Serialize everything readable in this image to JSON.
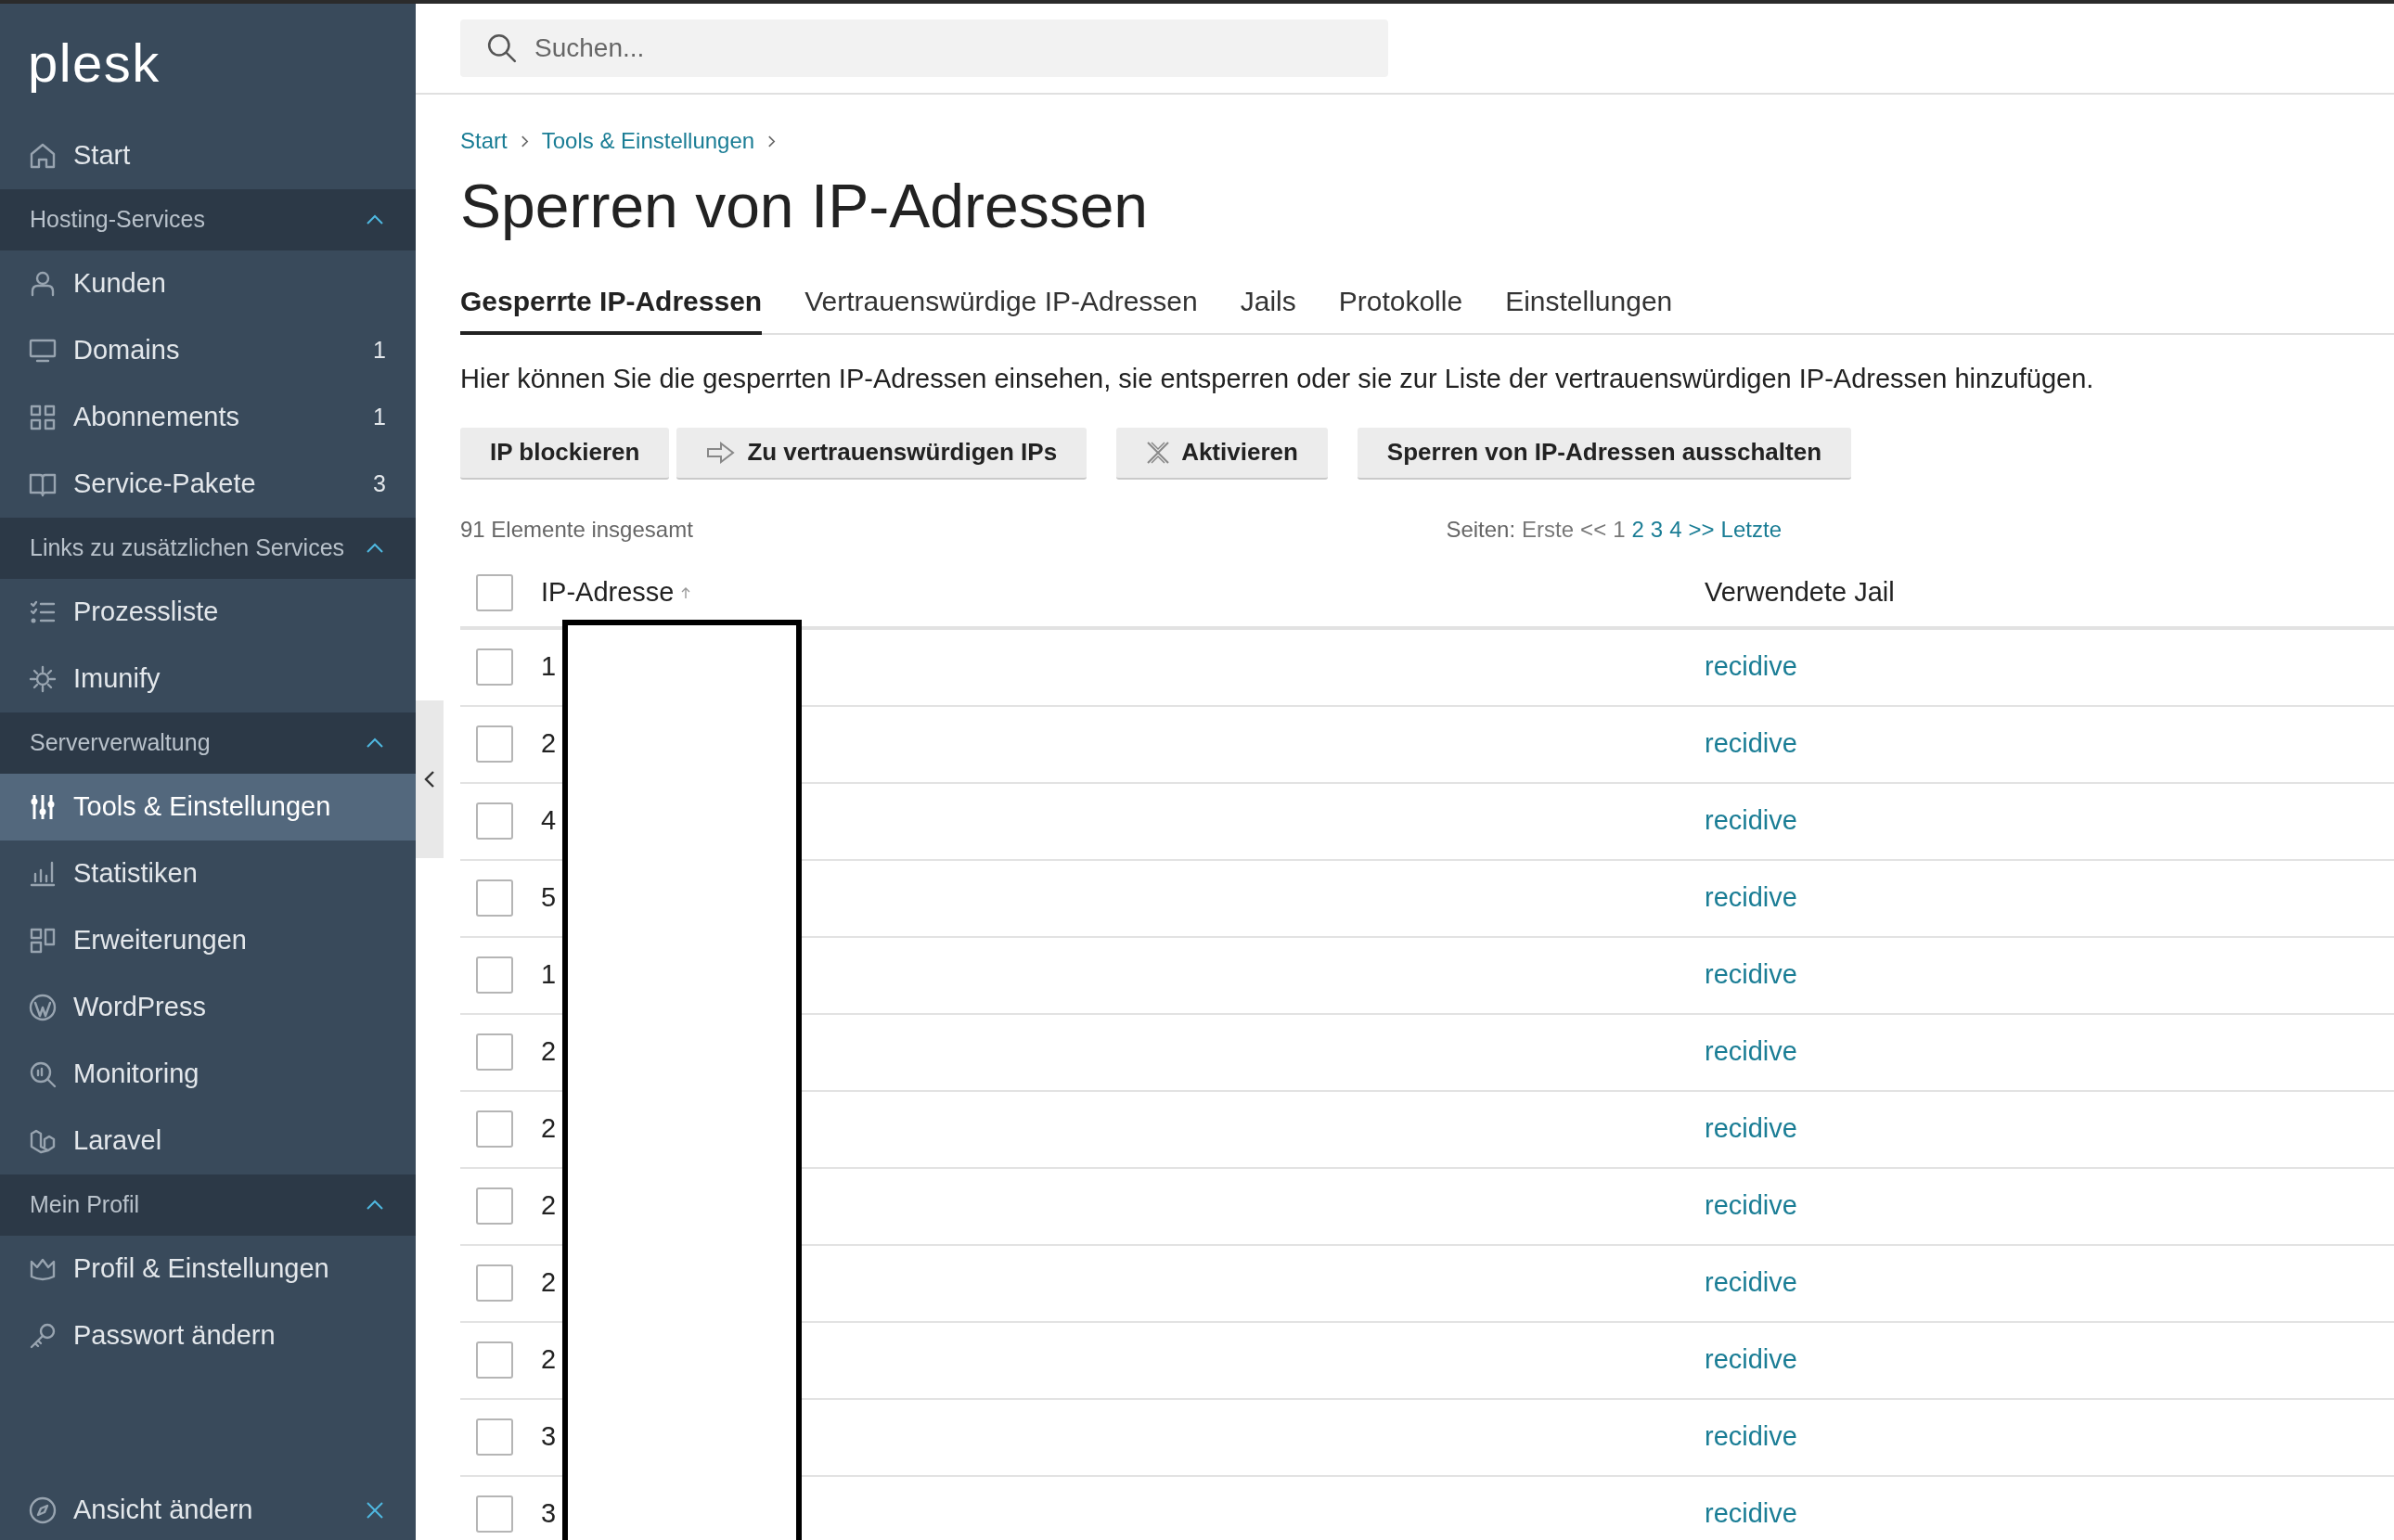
{
  "logo": "plesk",
  "search": {
    "placeholder": "Suchen..."
  },
  "sidebar": {
    "top_item": {
      "label": "Start",
      "selected": false
    },
    "sections": [
      {
        "title": "Hosting-Services",
        "expanded": true,
        "items": [
          {
            "label": "Kunden",
            "selected": false
          },
          {
            "label": "Domains",
            "badge": "1",
            "selected": false
          },
          {
            "label": "Abonnements",
            "badge": "1",
            "selected": false
          },
          {
            "label": "Service-Pakete",
            "badge": "3",
            "selected": false
          }
        ]
      },
      {
        "title": "Links zu zusätzlichen Services",
        "expanded": true,
        "items": [
          {
            "label": "Prozessliste",
            "selected": false
          },
          {
            "label": "Imunify",
            "selected": false
          }
        ]
      },
      {
        "title": "Serververwaltung",
        "expanded": true,
        "items": [
          {
            "label": "Tools & Einstellungen",
            "selected": true
          },
          {
            "label": "Statistiken",
            "selected": false
          },
          {
            "label": "Erweiterungen",
            "selected": false
          },
          {
            "label": "WordPress",
            "selected": false
          },
          {
            "label": "Monitoring",
            "selected": false
          },
          {
            "label": "Laravel",
            "selected": false
          }
        ]
      },
      {
        "title": "Mein Profil",
        "expanded": true,
        "items": [
          {
            "label": "Profil & Einstellungen",
            "selected": false
          },
          {
            "label": "Passwort ändern",
            "selected": false
          }
        ]
      }
    ],
    "footer": {
      "label": "Ansicht ändern"
    }
  },
  "breadcrumb": [
    "Start",
    "Tools & Einstellungen"
  ],
  "title": "Sperren von IP-Adressen",
  "tabs": [
    {
      "label": "Gesperrte IP-Adressen",
      "selected": true
    },
    {
      "label": "Vertrauenswürdige IP-Adressen",
      "selected": false
    },
    {
      "label": "Jails",
      "selected": false
    },
    {
      "label": "Protokolle",
      "selected": false
    },
    {
      "label": "Einstellungen",
      "selected": false
    }
  ],
  "description": "Hier können Sie die gesperrten IP-Adressen einsehen, sie entsperren oder sie zur Liste der vertrauenswürdigen IP-Adressen hinzufügen.",
  "toolbar": [
    [
      {
        "label": "IP blockieren"
      },
      {
        "label": "Zu vertrauenswürdigen IPs"
      }
    ],
    [
      {
        "label": "Aktivieren"
      }
    ],
    [
      {
        "label": "Sperren von IP-Adressen ausschalten"
      }
    ]
  ],
  "total": "91 Elemente insgesamt",
  "pagination": {
    "label": "Seiten:",
    "first": {
      "label": "Erste",
      "disabled": true
    },
    "prev": {
      "label": "<<",
      "disabled": true
    },
    "pages": [
      {
        "label": "1",
        "selected": true
      },
      {
        "label": "2",
        "selected": false
      },
      {
        "label": "3",
        "selected": false
      },
      {
        "label": "4",
        "selected": false
      }
    ],
    "next": {
      "label": ">>",
      "disabled": false
    },
    "last": {
      "label": "Letzte",
      "disabled": false
    }
  },
  "table": {
    "columns": [
      {
        "label": "IP-Adresse",
        "sorted_ascending": true
      },
      {
        "label": "Verwendete Jail"
      }
    ],
    "all_checked": false,
    "rows": [
      {
        "ip": "1",
        "jail": "recidive",
        "checked": false
      },
      {
        "ip": "2",
        "jail": "recidive",
        "checked": false
      },
      {
        "ip": "4",
        "jail": "recidive",
        "checked": false
      },
      {
        "ip": "5",
        "jail": "recidive",
        "checked": false
      },
      {
        "ip": "1",
        "jail": "recidive",
        "checked": false
      },
      {
        "ip": "2",
        "jail": "recidive",
        "checked": false
      },
      {
        "ip": "2",
        "jail": "recidive",
        "checked": false
      },
      {
        "ip": "2",
        "jail": "recidive",
        "checked": false
      },
      {
        "ip": "2",
        "jail": "recidive",
        "checked": false
      },
      {
        "ip": "2",
        "jail": "recidive",
        "checked": false
      },
      {
        "ip": "3",
        "jail": "recidive",
        "checked": false
      },
      {
        "ip": "3",
        "jail": "recidive",
        "checked": false
      }
    ]
  }
}
